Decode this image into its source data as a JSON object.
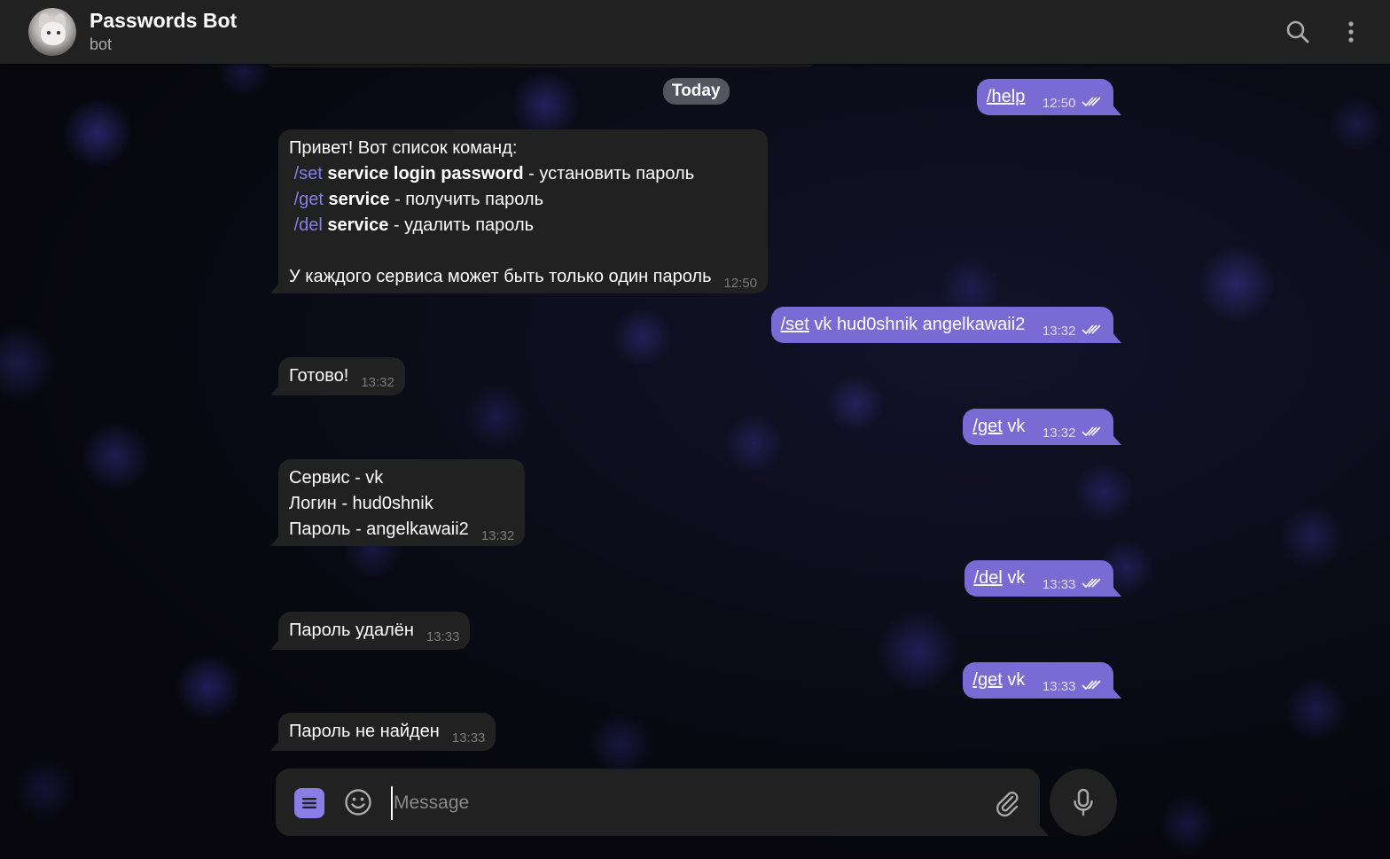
{
  "header": {
    "title": "Passwords Bot",
    "subtitle": "bot"
  },
  "date_separator": "Today",
  "messages": [
    {
      "dir": "out",
      "cmd": "/help",
      "rest": "",
      "time": "12:50"
    },
    {
      "dir": "in",
      "lines": [
        {
          "text": "Привет! Вот список команд:"
        },
        {
          "cmd": "/set",
          "bold": "service login password",
          "rest": " - установить пароль"
        },
        {
          "cmd": "/get",
          "bold": "service",
          "rest": " - получить пароль"
        },
        {
          "cmd": "/del",
          "bold": "service",
          "rest": " - удалить пароль"
        },
        {
          "text": ""
        },
        {
          "text": "У каждого сервиса может быть только один пароль"
        }
      ],
      "time": "12:50"
    },
    {
      "dir": "out",
      "cmd": "/set",
      "rest": " vk hud0shnik angelkawaii2",
      "time": "13:32"
    },
    {
      "dir": "in",
      "text": "Готово!",
      "time": "13:32"
    },
    {
      "dir": "out",
      "cmd": "/get",
      "rest": " vk",
      "time": "13:32"
    },
    {
      "dir": "in",
      "lines": [
        {
          "text": "Сервис - vk"
        },
        {
          "text": "Логин - hud0shnik"
        },
        {
          "text": "Пароль - angelkawaii2"
        }
      ],
      "time": "13:32"
    },
    {
      "dir": "out",
      "cmd": "/del",
      "rest": " vk",
      "time": "13:33"
    },
    {
      "dir": "in",
      "text": "Пароль удалён",
      "time": "13:33"
    },
    {
      "dir": "out",
      "cmd": "/get",
      "rest": " vk",
      "time": "13:33"
    },
    {
      "dir": "in",
      "text": "Пароль не найден",
      "time": "13:33"
    }
  ],
  "composer": {
    "placeholder": "Message"
  },
  "icons": {
    "search": "search-icon",
    "more": "more-vertical-icon",
    "menu": "bot-menu-icon",
    "emoji": "emoji-icon",
    "attach": "paperclip-icon",
    "mic": "microphone-icon",
    "read": "double-check-icon"
  },
  "colors": {
    "accent": "#8a7de6",
    "outgoing_bubble": "#7a6bd4",
    "incoming_bubble": "#212121",
    "header_bg": "#212121"
  }
}
